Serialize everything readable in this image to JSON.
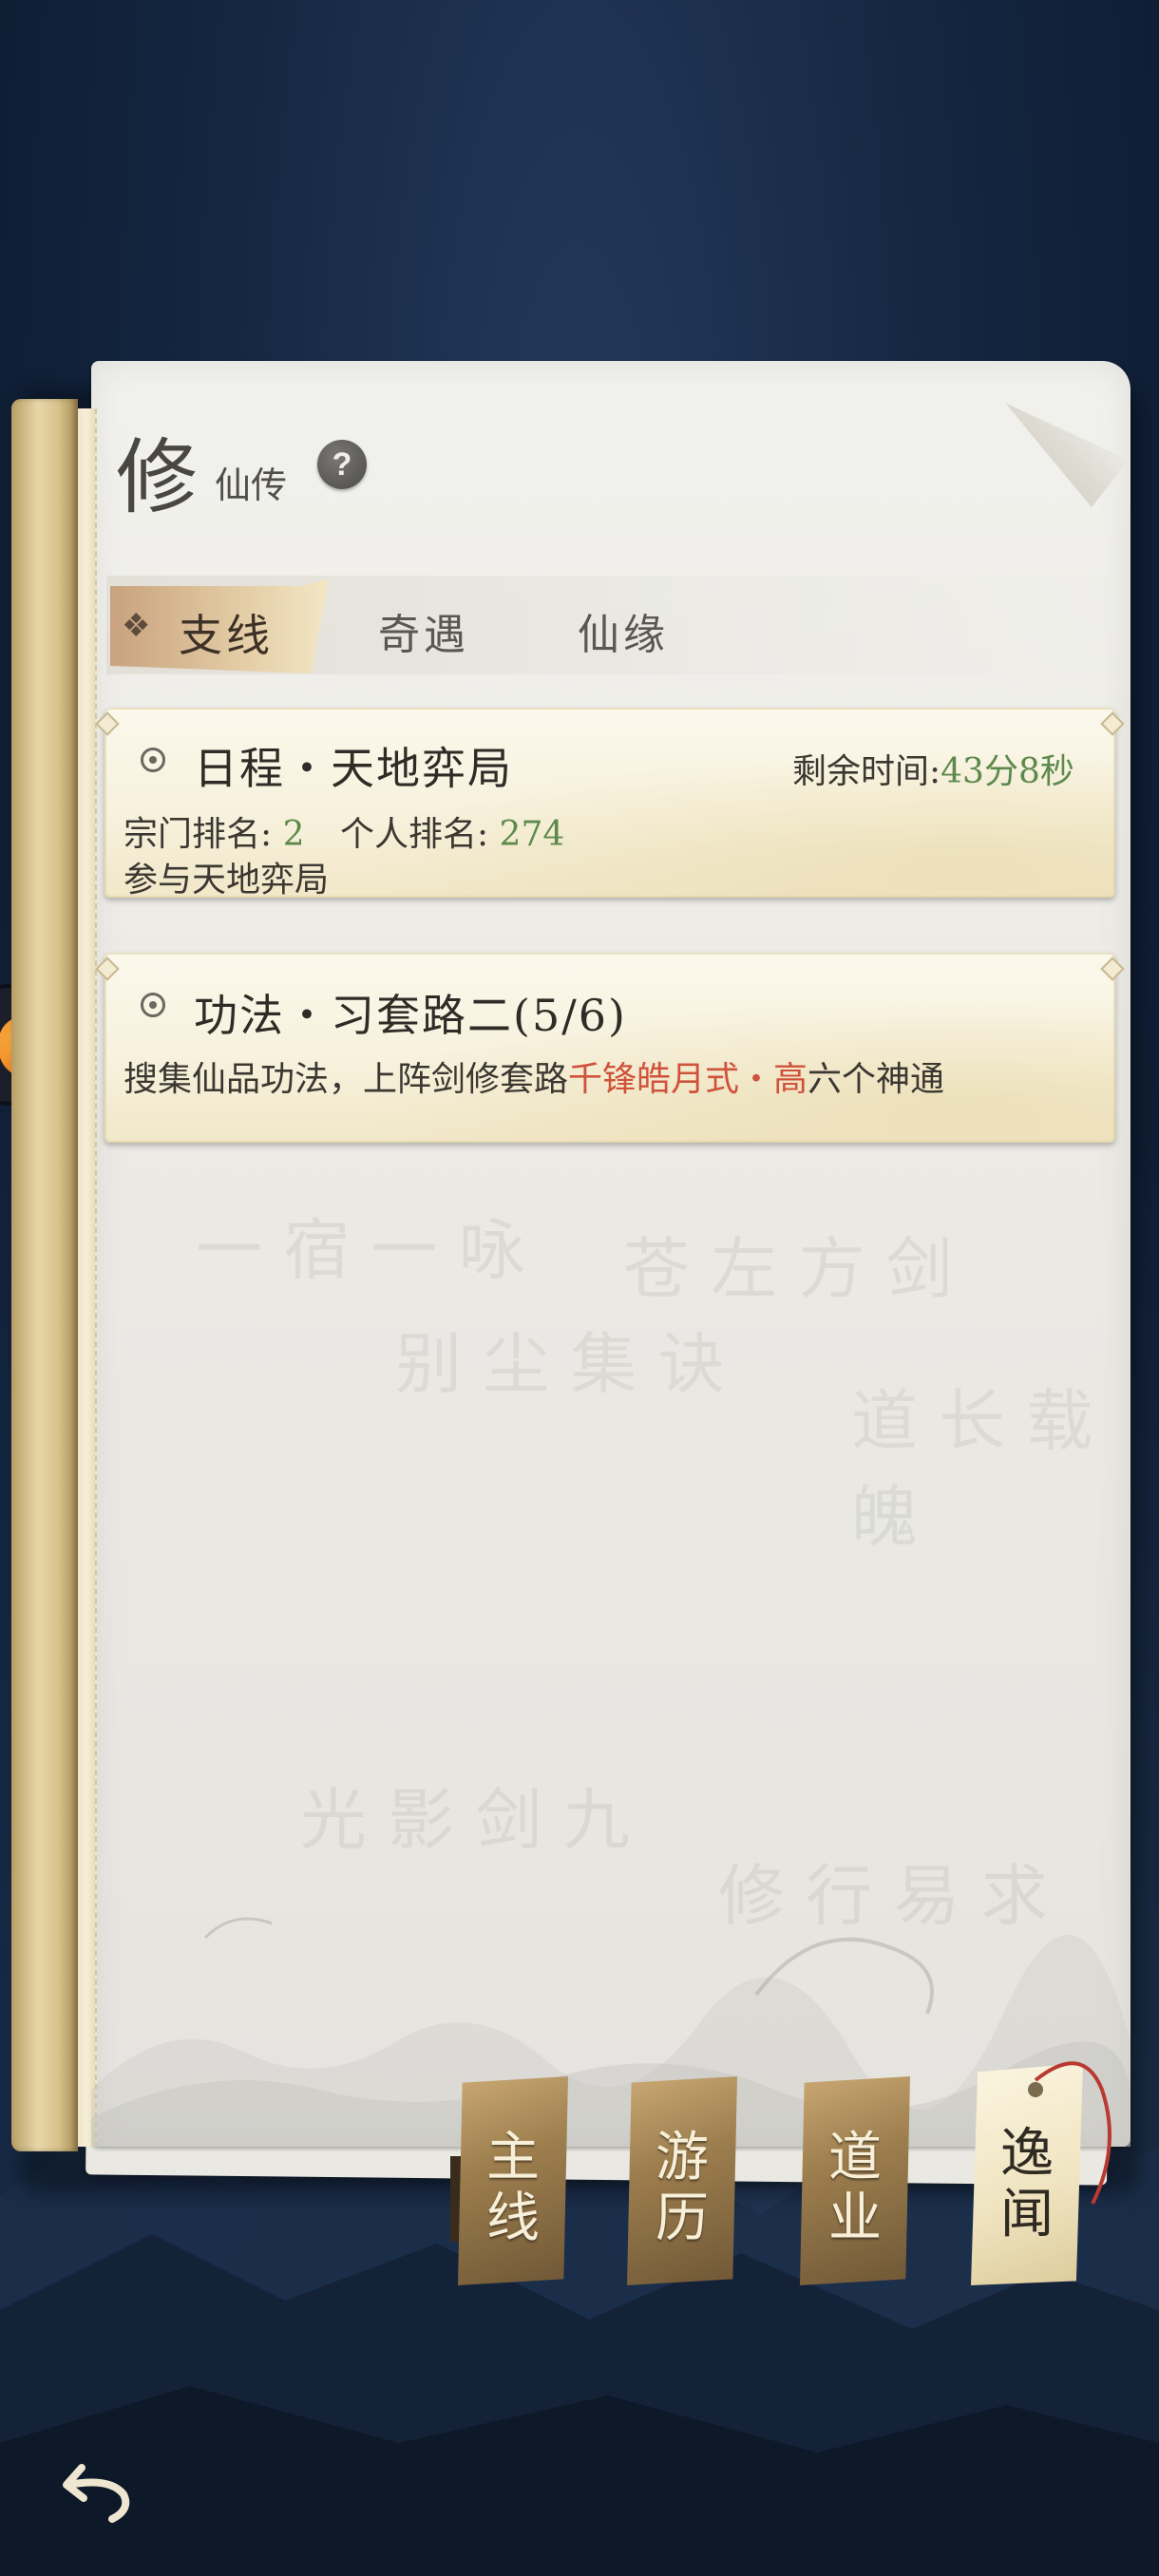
{
  "header": {
    "title_big": "修",
    "title_small": "仙传",
    "help": "?"
  },
  "tabs": [
    {
      "label": "支线",
      "active": true
    },
    {
      "label": "奇遇",
      "active": false
    },
    {
      "label": "仙缘",
      "active": false
    }
  ],
  "quests": [
    {
      "title": "日程・天地弈局",
      "time_label": "剩余时间:",
      "time_value": "43分8秒",
      "sect_rank_label": "宗门排名:",
      "sect_rank_value": "2",
      "personal_rank_label": "个人排名:",
      "personal_rank_value": "274",
      "description": "参与天地弈局"
    },
    {
      "title": "功法・习套路二(5/6)",
      "desc_part1": "搜集仙品功法，上阵剑修套路",
      "desc_highlight": "千锋皓月式・高",
      "desc_part2": "六个神通"
    }
  ],
  "bookmarks": [
    {
      "label_top": "主",
      "label_bottom": "线",
      "active": false
    },
    {
      "label_top": "游",
      "label_bottom": "历",
      "active": false
    },
    {
      "label_top": "道",
      "label_bottom": "业",
      "active": false
    },
    {
      "label_top": "逸",
      "label_bottom": "闻",
      "active": true
    }
  ],
  "colors": {
    "accent_green": "#5d8a4c",
    "accent_red": "#d0523b",
    "tab_active": "#e1c9a2",
    "bookmark": "#9d7e4e"
  },
  "icons": {
    "help": "question-icon",
    "back": "back-arrow-icon",
    "bullet": "radio-bullet-icon",
    "tab_marker": "diamond-icon"
  }
}
